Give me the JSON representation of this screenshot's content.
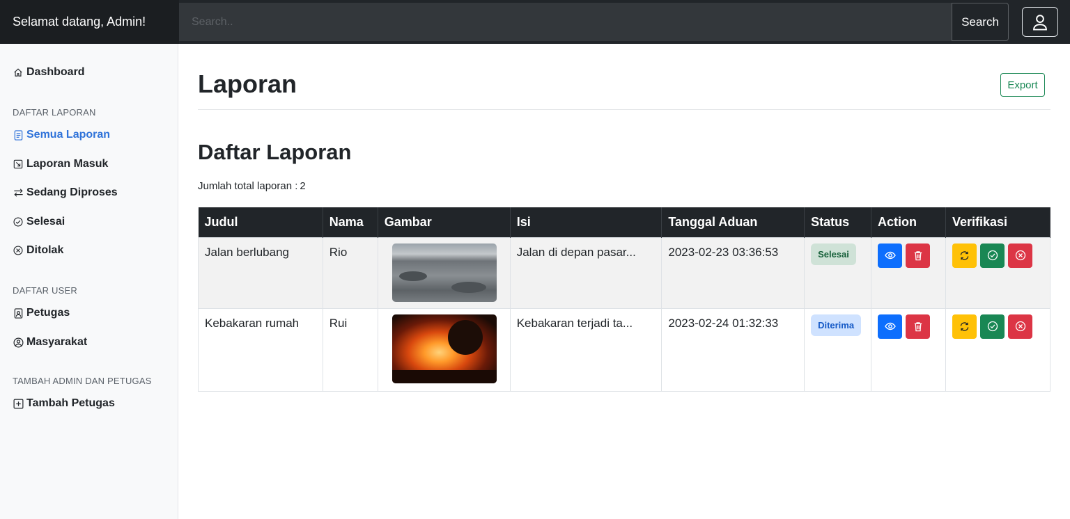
{
  "navbar": {
    "brand": "Selamat datang, Admin!",
    "search_placeholder": "Search..",
    "search_label": "Search",
    "user_icon": "person-icon"
  },
  "sidebar": {
    "dashboard": "Dashboard",
    "heading_laporan": "DAFTAR LAPORAN",
    "laporan_items": [
      {
        "label": "Semua Laporan",
        "icon": "file-text-icon",
        "active": true
      },
      {
        "label": "Laporan Masuk",
        "icon": "box-arrow-in-icon"
      },
      {
        "label": "Sedang Diproses",
        "icon": "arrow-left-right-icon"
      },
      {
        "label": "Selesai",
        "icon": "check-circle-icon"
      },
      {
        "label": "Ditolak",
        "icon": "x-circle-icon"
      }
    ],
    "heading_user": "DAFTAR USER",
    "user_items": [
      {
        "label": "Petugas",
        "icon": "person-badge-icon"
      },
      {
        "label": "Masyarakat",
        "icon": "person-circle-icon"
      }
    ],
    "heading_tambah": "TAMBAH ADMIN DAN PETUGAS",
    "tambah_items": [
      {
        "label": "Tambah Petugas",
        "icon": "plus-square-icon"
      }
    ]
  },
  "main": {
    "title": "Laporan",
    "export_label": "Export",
    "section_title": "Daftar Laporan",
    "total_label": "Jumlah total laporan :",
    "total_value": "2",
    "columns": [
      "Judul",
      "Nama",
      "Gambar",
      "Isi",
      "Tanggal Aduan",
      "Status",
      "Action",
      "Verifikasi"
    ],
    "rows": [
      {
        "judul": "Jalan berlubang",
        "nama": "Rio",
        "gambar": "pothole-road-photo",
        "isi": "Jalan di depan pasar...",
        "tanggal": "2023-02-23 03:36:53",
        "status": "Selesai"
      },
      {
        "judul": "Kebakaran rumah",
        "nama": "Rui",
        "gambar": "house-fire-photo",
        "isi": "Kebakaran terjadi ta...",
        "tanggal": "2023-02-24 01:32:33",
        "status": "Diterima"
      }
    ]
  },
  "colors": {
    "navbar": "#212529",
    "accent_blue": "#0d6efd",
    "danger": "#dc3545",
    "warning": "#ffc107",
    "success": "#198754",
    "sidebar_active": "#2e72d9"
  }
}
